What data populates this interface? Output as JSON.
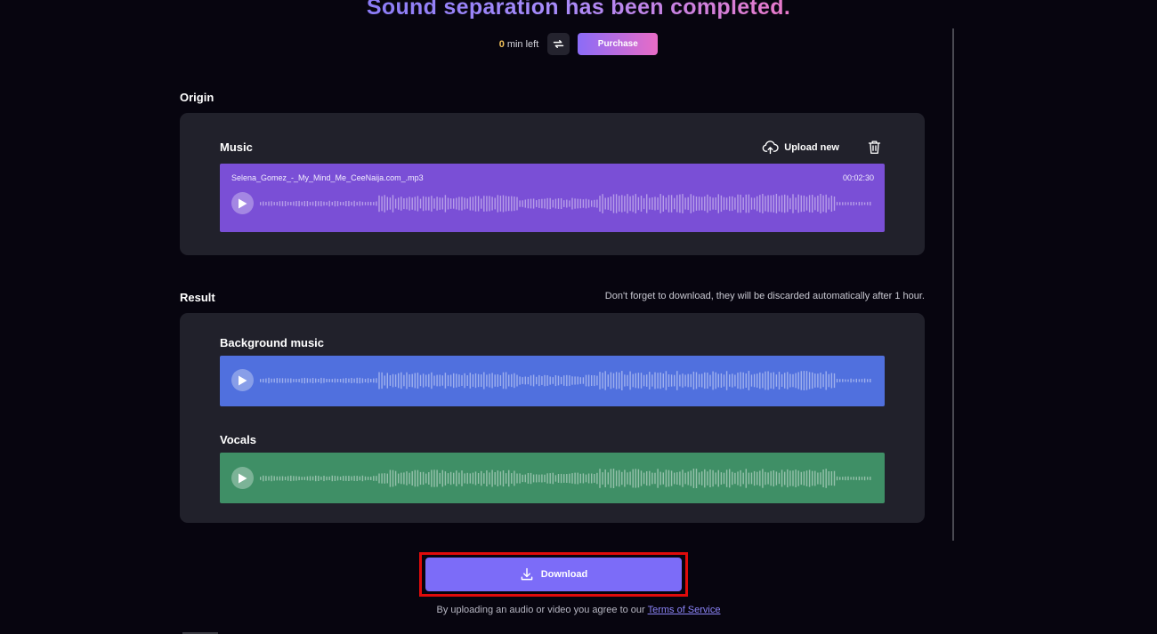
{
  "header": {
    "title": "Sound separation has been completed.",
    "quota_value": "0",
    "quota_suffix": "min left",
    "purchase_label": "Purchase"
  },
  "origin": {
    "section_label": "Origin",
    "track_title": "Music",
    "upload_label": "Upload new",
    "file_name": "Selena_Gomez_-_My_Mind_Me_CeeNaija.com_.mp3",
    "duration": "00:02:30"
  },
  "result": {
    "section_label": "Result",
    "notice": "Don't forget to download, they will be discarded automatically after 1 hour.",
    "tracks": [
      {
        "title": "Background music"
      },
      {
        "title": "Vocals"
      }
    ]
  },
  "footer": {
    "download_label": "Download",
    "terms_prefix": "By uploading an audio or video you agree to our",
    "terms_link": "Terms of Service"
  },
  "colors": {
    "music_track": "#7a4fd6",
    "background_track": "#5070de",
    "vocals_track": "#3f8f66",
    "download_button": "#7c6cf8",
    "highlight": "#e00b0b"
  },
  "icons": {
    "refresh": "refresh-icon",
    "upload": "cloud-upload-icon",
    "delete": "trash-icon",
    "play": "play-icon",
    "download": "download-icon"
  }
}
